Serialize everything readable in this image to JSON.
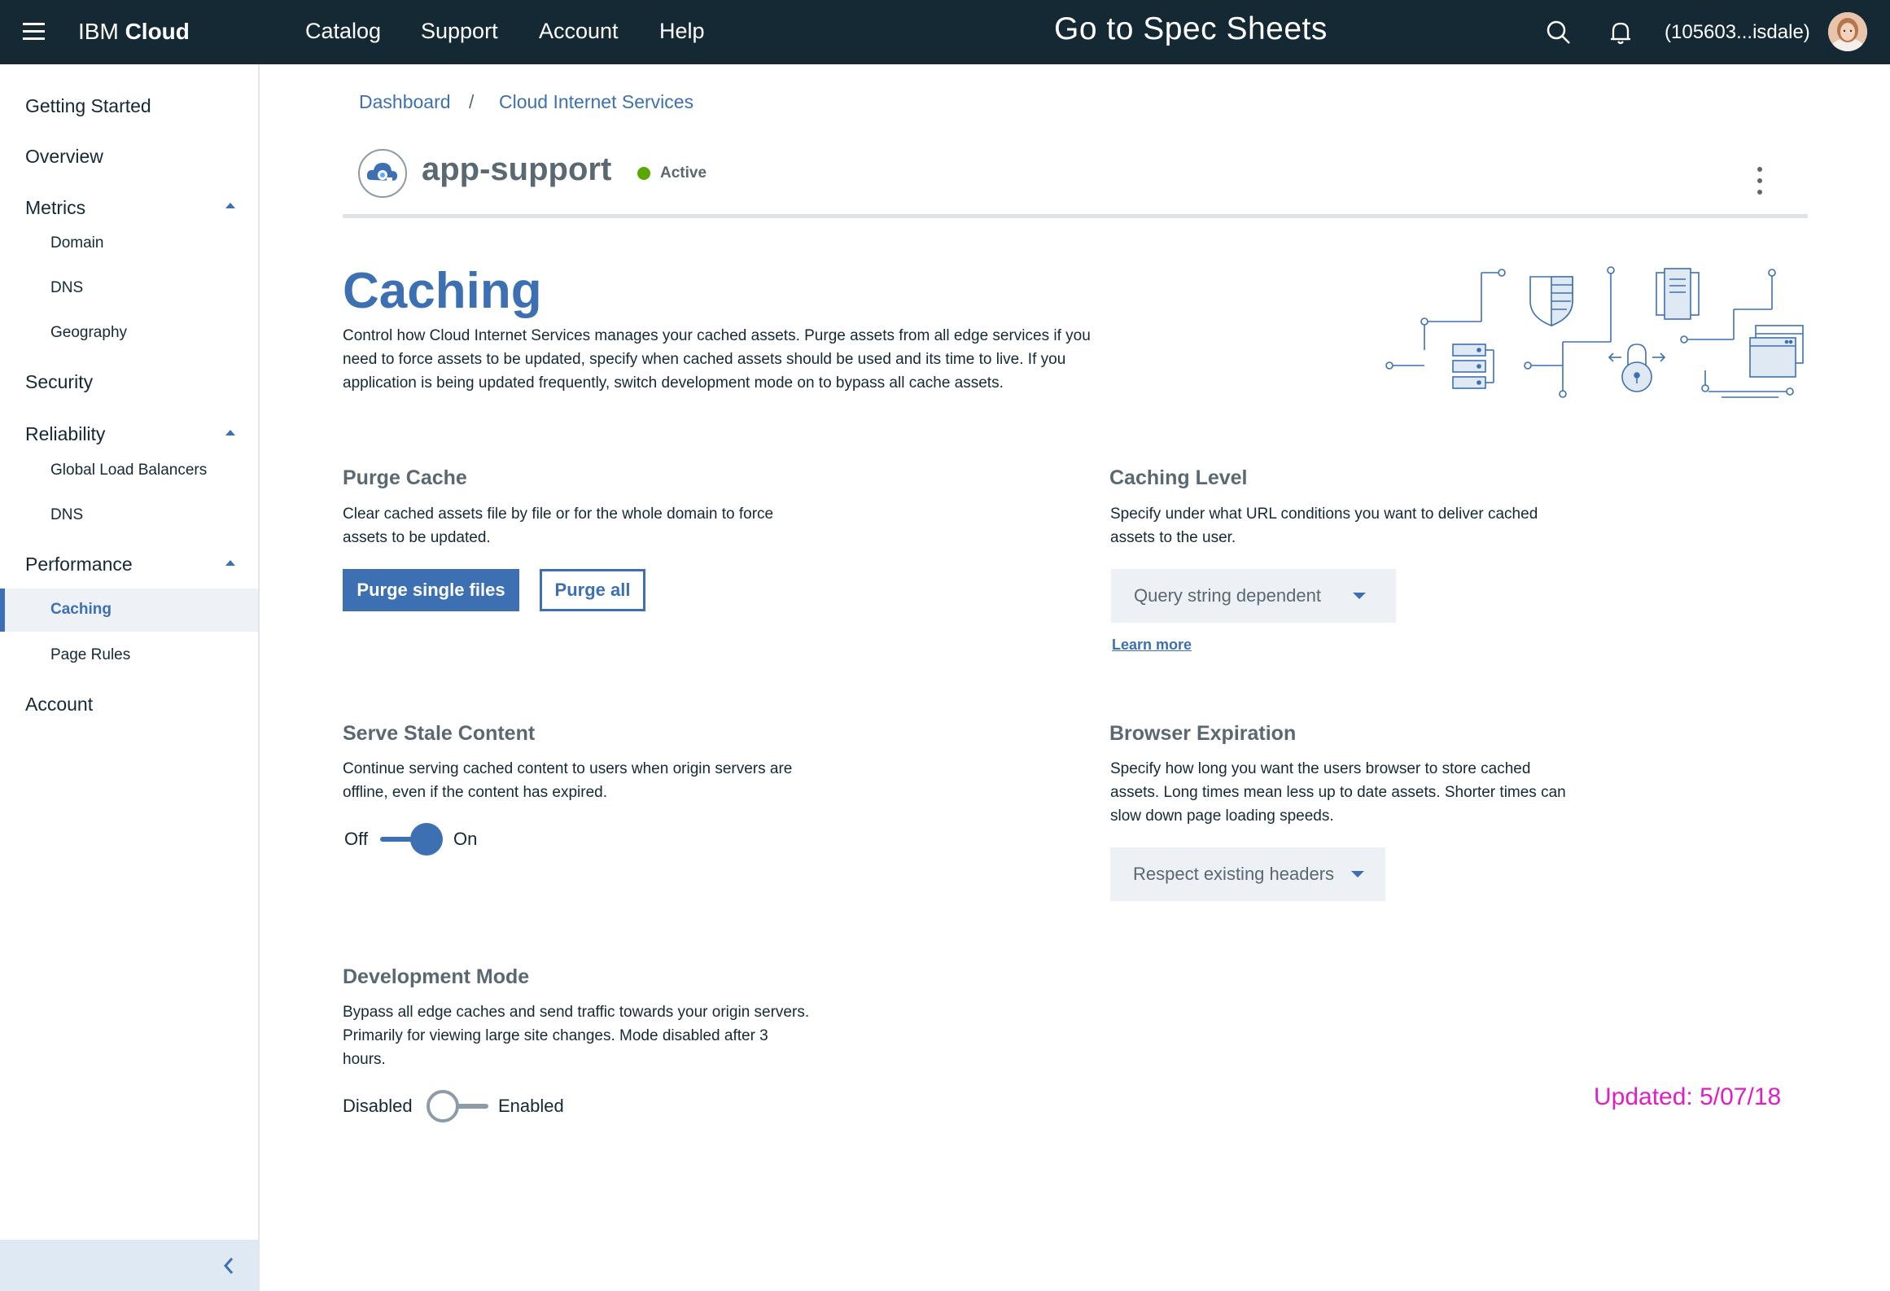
{
  "topbar": {
    "brand_prefix": "IBM",
    "brand_suffix": "Cloud",
    "nav": [
      "Catalog",
      "Support",
      "Account",
      "Help"
    ],
    "spec_link": "Go to Spec Sheets",
    "account_id": "(105603...isdale)"
  },
  "sidebar": {
    "getting_started": "Getting Started",
    "overview": "Overview",
    "metrics": "Metrics",
    "metrics_items": [
      "Domain",
      "DNS",
      "Geography"
    ],
    "security": "Security",
    "reliability": "Reliability",
    "reliability_items": [
      "Global Load Balancers",
      "DNS"
    ],
    "performance": "Performance",
    "performance_items": [
      "Caching",
      "Page Rules"
    ],
    "account": "Account"
  },
  "breadcrumb": {
    "dashboard": "Dashboard",
    "separator": "/",
    "current": "Cloud Internet Services"
  },
  "resource": {
    "name": "app-support",
    "status": "Active",
    "status_color": "#5aa700"
  },
  "page": {
    "title": "Caching",
    "description": "Control how Cloud Internet Services manages your cached assets. Purge assets from all edge services if you need to force assets to be updated, specify when cached assets should be used and its time to live. If you application is being updated frequently, switch development mode on to bypass all cache assets."
  },
  "purge": {
    "title": "Purge Cache",
    "description": "Clear cached assets file by file or for the whole domain to force assets to be updated.",
    "primary_button": "Purge single files",
    "secondary_button": "Purge all"
  },
  "caching_level": {
    "title": "Caching Level",
    "description": "Specify under what URL conditions you want to deliver cached assets to the user.",
    "selected": "Query string dependent",
    "learn_more": "Learn more"
  },
  "stale": {
    "title": "Serve Stale Content",
    "description": "Continue serving cached content to users when origin servers are offline, even if the content has expired.",
    "off_label": "Off",
    "on_label": "On",
    "state": "on"
  },
  "browser_expiration": {
    "title": "Browser Expiration",
    "description": "Specify how long you want the users browser to store cached assets. Long times mean less up to date assets. Shorter times can slow down page loading speeds.",
    "selected": "Respect existing headers"
  },
  "dev_mode": {
    "title": "Development Mode",
    "description": "Bypass all edge caches and send traffic towards your origin servers. Primarily for viewing large site changes. Mode disabled after 3 hours.",
    "off_label": "Disabled",
    "on_label": "Enabled",
    "state": "off"
  },
  "annotation": {
    "updated": "Updated: 5/07/18"
  },
  "colors": {
    "accent": "#3d70b2",
    "header_bg": "#152935",
    "annotation": "#e01ec6"
  }
}
